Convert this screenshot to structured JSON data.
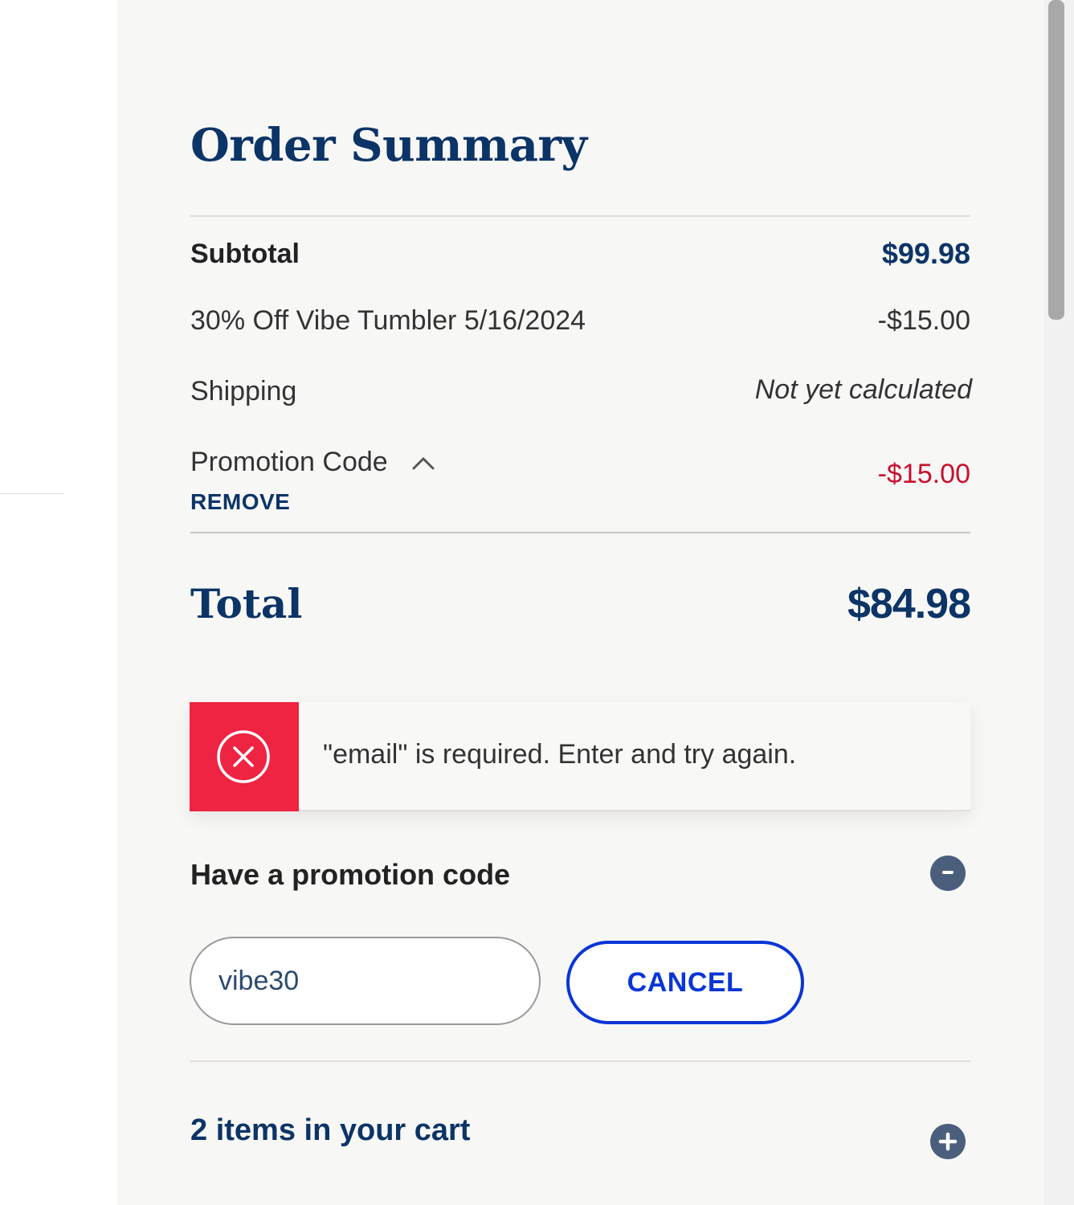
{
  "summary": {
    "title": "Order Summary",
    "subtotal_label": "Subtotal",
    "subtotal_value": "$99.98",
    "discount_label": "30% Off Vibe Tumbler 5/16/2024",
    "discount_value": "-$15.00",
    "shipping_label": "Shipping",
    "shipping_value": "Not yet calculated",
    "promo_label": "Promotion Code",
    "promo_remove_label": "REMOVE",
    "promo_value": "-$15.00",
    "total_label": "Total",
    "total_value": "$84.98"
  },
  "alert": {
    "icon": "error-circle-x-icon",
    "message": "\"email\" is required. Enter and try again.",
    "color": "#ef2342"
  },
  "promotion": {
    "heading": "Have a promotion code",
    "toggle_icon": "minus-circle-icon",
    "input_value": "vibe30",
    "cancel_label": "CANCEL"
  },
  "cart": {
    "heading": "2 items in your cart",
    "toggle_icon": "plus-circle-icon"
  },
  "colors": {
    "brand_navy": "#0c3466",
    "discount_red": "#c8102e",
    "button_blue": "#0a35d6"
  }
}
